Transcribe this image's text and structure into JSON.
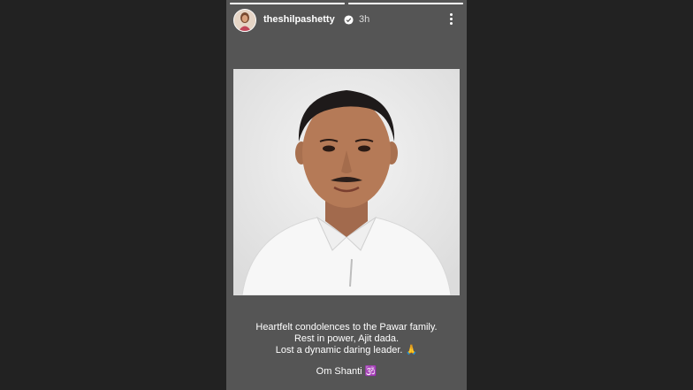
{
  "story": {
    "username": "theshilpashetty",
    "time": "3h",
    "verified_icon": "verified-badge-icon",
    "more_icon": "more-options-icon",
    "progress": [
      1,
      1
    ]
  },
  "photo": {
    "description": "portrait photo"
  },
  "caption": {
    "line1": "Heartfelt condolences to the Pawar family.",
    "line2": "Rest in power, Ajit dada.",
    "line3": "Lost a dynamic daring leader. 🙏",
    "line4": "Om Shanti 🕉️"
  },
  "colors": {
    "background": "#222222",
    "story_bg": "#555555",
    "verified": "#3897f0"
  }
}
